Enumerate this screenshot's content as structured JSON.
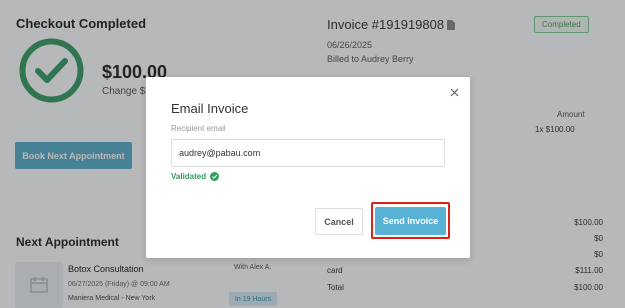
{
  "checkout": {
    "title": "Checkout Completed",
    "amount": "$100.00",
    "change_label": "Change $",
    "book_button": "Book Next Appointment"
  },
  "next_appointment": {
    "title": "Next Appointment",
    "service": "Botox Consultation",
    "with": "With Alex A.",
    "datetime": "06/27/2025 (Friday) @ 09:00 AM",
    "location": "Maniera Medical - New York",
    "badge": "In 19 Hours"
  },
  "invoice": {
    "title": "Invoice #191919808",
    "status": "Completed",
    "date": "06/26/2025",
    "billed_to": "Billed to Audrey Berry",
    "amount_header": "Amount",
    "line_item": "1x $100.00",
    "totals": [
      {
        "label": "",
        "value": "$100.00"
      },
      {
        "label": "",
        "value": "$0"
      },
      {
        "label": "",
        "value": "$0"
      },
      {
        "label": "card",
        "value": "$111.00"
      },
      {
        "label": "Total",
        "value": "$100.00"
      }
    ]
  },
  "modal": {
    "title": "Email Invoice",
    "recipient_label": "Recipient email",
    "recipient_value": "audrey@pabau.com",
    "validated_text": "Validated",
    "cancel_label": "Cancel",
    "send_label": "Send Invoice"
  },
  "colors": {
    "accent": "#58b2d6",
    "success": "#2f9e5c",
    "check_ring": "#3a9d63",
    "highlight": "#d6241b"
  },
  "icons": [
    "check-circle-icon",
    "calendar-thumb-icon",
    "document-icon",
    "close-icon",
    "validated-check-icon"
  ]
}
